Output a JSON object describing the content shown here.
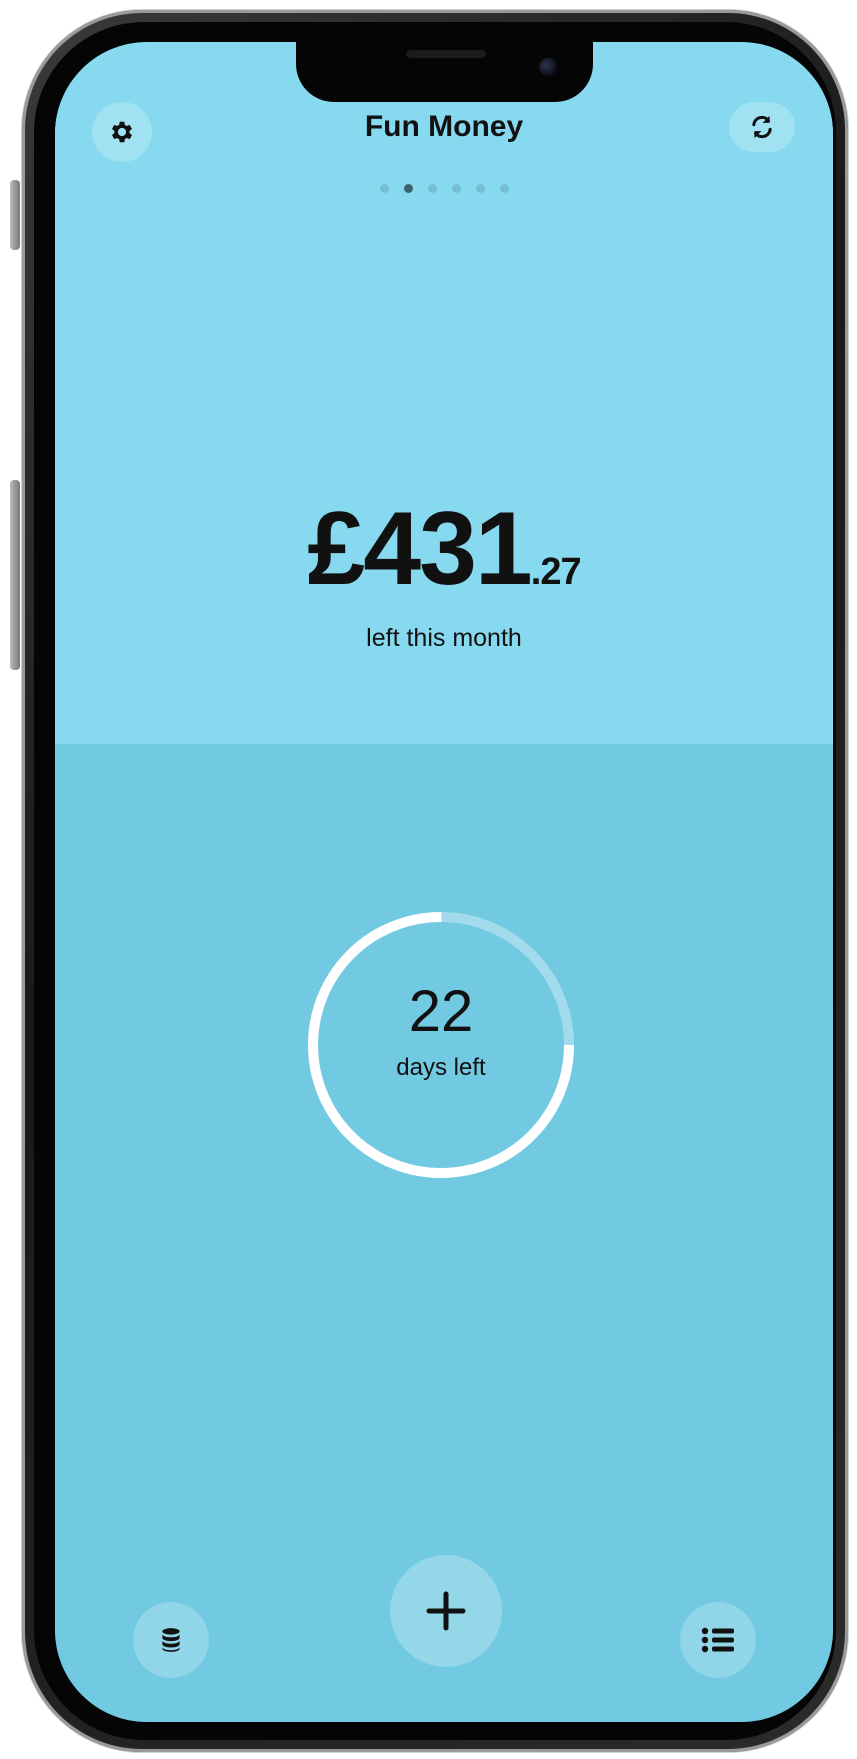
{
  "header": {
    "title": "Fun Money",
    "settings_icon": "gear-icon",
    "refresh_icon": "refresh-icon"
  },
  "pager": {
    "count": 6,
    "active_index": 1
  },
  "balance": {
    "main": "£431",
    "cents": ".27",
    "caption": "left this month"
  },
  "countdown": {
    "days": "22",
    "label": "days left",
    "progress_fraction": 0.75
  },
  "footer": {
    "coins_icon": "coins-icon",
    "add_icon": "plus-icon",
    "list_icon": "list-icon"
  },
  "colors": {
    "top_panel": "#86d9ef",
    "bottom_panel": "#71cae2",
    "ring": "#ffffff"
  }
}
